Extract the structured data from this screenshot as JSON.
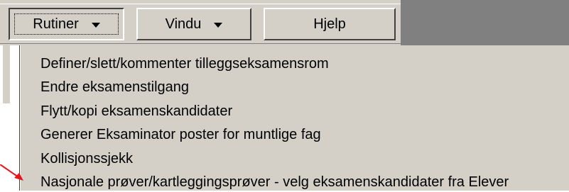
{
  "toolbar": {
    "rutiner_label": "Rutiner",
    "vindu_label": "Vindu",
    "hjelp_label": "Hjelp"
  },
  "menu": {
    "items": [
      {
        "label": "Definer/slett/kommenter tilleggseksamensrom"
      },
      {
        "label": "Endre eksamenstilgang"
      },
      {
        "label": "Flytt/kopi eksamenskandidater"
      },
      {
        "label": "Generer Eksaminator poster for muntlige fag"
      },
      {
        "label": "Kollisjonssjekk"
      },
      {
        "label": "Nasjonale prøver/kartleggingsprøver - velg eksamenskandidater fra Elever"
      }
    ]
  },
  "colors": {
    "face": "#d4d0c8",
    "dark_area": "#808080",
    "pointer_arrow": "#e8141c"
  },
  "icons": {
    "pointer": "red-arrow-icon"
  }
}
